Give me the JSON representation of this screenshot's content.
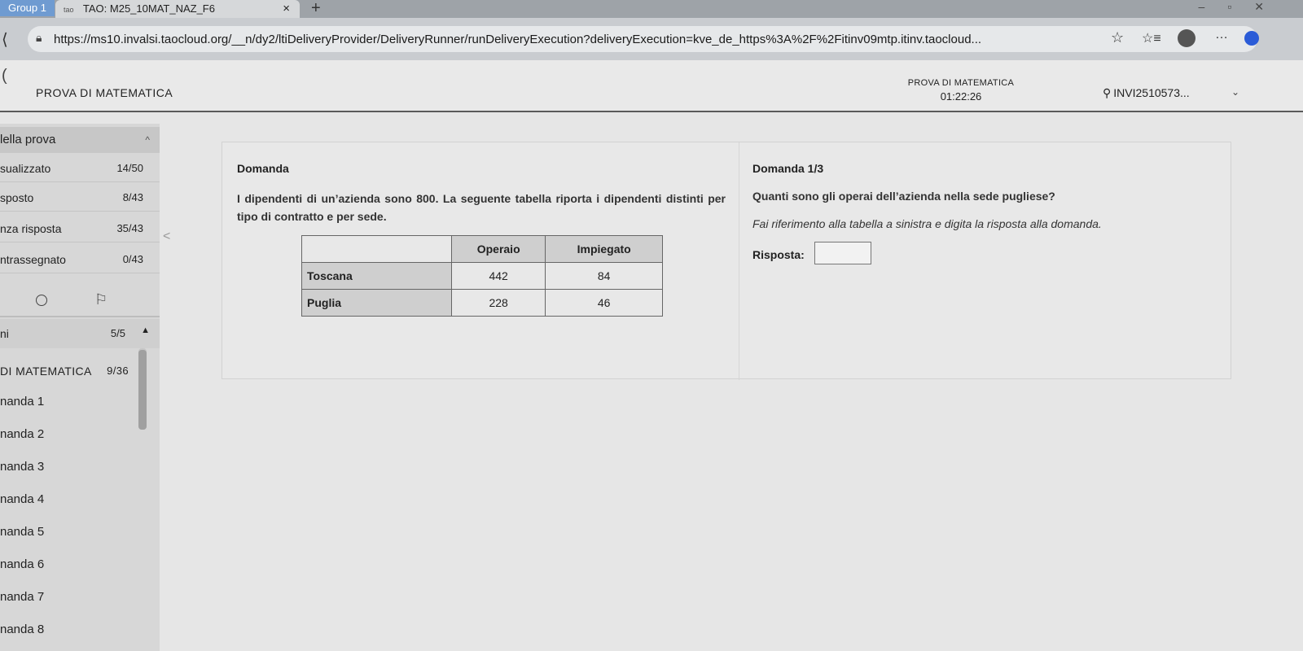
{
  "browser": {
    "tab_group": "Group 1",
    "tab_favicon": "tao",
    "tab_title": "TAO: M25_10MAT_NAZ_F6",
    "tab_close": "×",
    "new_tab": "+",
    "url": "https://ms10.invalsi.taocloud.org/__n/dy2/ltiDeliveryProvider/DeliveryRunner/runDeliveryExecution?deliveryExecution=kve_de_https%3A%2F%2Fitinv09mtp.itinv.taocloud..."
  },
  "header": {
    "title": "PROVA DI MATEMATICA",
    "center_title": "PROVA DI MATEMATICA",
    "timer": "01:22:26",
    "user": "INVI2510573..."
  },
  "sidebar": {
    "section_title": "lella prova",
    "stats": [
      {
        "label": "sualizzato",
        "count": "14/50"
      },
      {
        "label": "sposto",
        "count": "8/43"
      },
      {
        "label": "nza risposta",
        "count": "35/43"
      },
      {
        "label": "ntrassegnato",
        "count": "0/43"
      }
    ],
    "group": {
      "label": "ni",
      "count": "5/5"
    },
    "part": {
      "label": "DI MATEMATICA",
      "count": "9/36"
    },
    "items": [
      "nanda 1",
      "nanda 2",
      "nanda 3",
      "nanda 4",
      "nanda 5",
      "nanda 6",
      "nanda 7",
      "nanda 8"
    ]
  },
  "left_panel": {
    "heading": "Domanda",
    "stem": "I dipendenti di un’azienda sono 800. La seguente tabella riporta i dipendenti distinti per tipo di contratto e per sede.",
    "table": {
      "columns": [
        "Operaio",
        "Impiegato"
      ],
      "rows": [
        {
          "label": "Toscana",
          "values": [
            "442",
            "84"
          ]
        },
        {
          "label": "Puglia",
          "values": [
            "228",
            "46"
          ]
        }
      ]
    }
  },
  "right_panel": {
    "counter": "Domanda 1/3",
    "question": "Quanti sono gli operai dell’azienda nella sede pugliese?",
    "instruction": "Fai riferimento alla tabella a sinistra e digita la risposta alla domanda.",
    "answer_label": "Risposta:",
    "answer_value": ""
  }
}
